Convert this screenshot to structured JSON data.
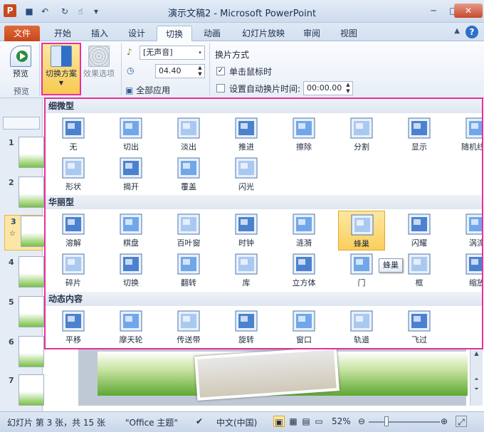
{
  "window": {
    "title": "演示文稿2 - Microsoft PowerPoint",
    "app_icon_letter": "P",
    "qat_icons": [
      "save-icon",
      "undo-icon",
      "redo-icon",
      "touch-icon",
      "customize-icon"
    ]
  },
  "tabs": [
    {
      "label": "文件"
    },
    {
      "label": "开始"
    },
    {
      "label": "插入"
    },
    {
      "label": "设计"
    },
    {
      "label": "切换"
    },
    {
      "label": "动画"
    },
    {
      "label": "幻灯片放映"
    },
    {
      "label": "审阅"
    },
    {
      "label": "视图"
    }
  ],
  "ribbon": {
    "preview_label": "预览",
    "preview_group_label": "预览",
    "scheme_label": "切换方案",
    "effect_label": "效果选项",
    "sound_value": "[无声音]",
    "duration_value": "04.40",
    "apply_all_label": "全部应用",
    "switch_mode_label": "换片方式",
    "on_click_label": "单击鼠标时",
    "auto_label": "设置自动换片时间:",
    "auto_value": "00:00.00"
  },
  "slides": [
    {
      "num": "1"
    },
    {
      "num": "2"
    },
    {
      "num": "3"
    },
    {
      "num": "4"
    },
    {
      "num": "5"
    },
    {
      "num": "6"
    },
    {
      "num": "7"
    }
  ],
  "gallery": {
    "sections": [
      {
        "label": "细微型"
      },
      {
        "label": "华丽型"
      },
      {
        "label": "动态内容"
      }
    ],
    "subtle": [
      "无",
      "切出",
      "淡出",
      "推进",
      "擦除",
      "分割",
      "显示",
      "随机线条",
      "形状",
      "揭开",
      "覆盖",
      "闪光"
    ],
    "exciting": [
      "溶解",
      "棋盘",
      "百叶窗",
      "时钟",
      "涟漪",
      "蜂巢",
      "闪耀",
      "涡流",
      "碎片",
      "切换",
      "翻转",
      "库",
      "立方体",
      "门",
      "框",
      "缩放"
    ],
    "dynamic": [
      "平移",
      "摩天轮",
      "传送带",
      "旋转",
      "窗口",
      "轨道",
      "飞过"
    ],
    "tooltip": "蜂巢"
  },
  "status": {
    "slide_info": "幻灯片 第 3 张，共 15 张",
    "theme": "\"Office 主题\"",
    "language": "中文(中国)",
    "zoom": "52%"
  },
  "colors": {
    "highlight": "#e6309e",
    "file_tab": "#c8461c",
    "selected_item": "#f9cf5c"
  }
}
